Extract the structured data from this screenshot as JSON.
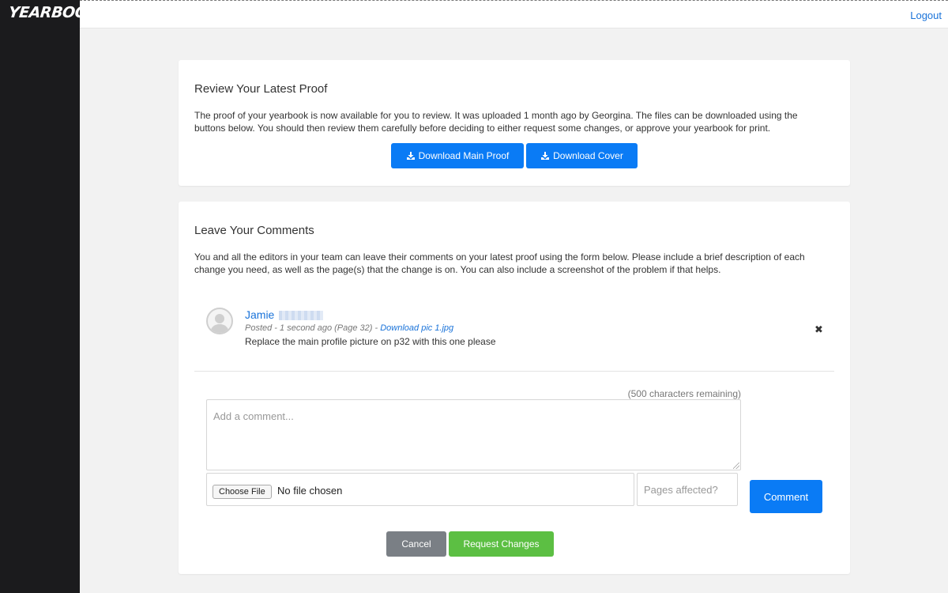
{
  "app": {
    "logo_text": "YEARBOOK",
    "logout_label": "Logout"
  },
  "proof_card": {
    "title": "Review Your Latest Proof",
    "description": "The proof of your yearbook is now available for you to review. It was uploaded 1 month ago by Georgina. The files can be downloaded using the buttons below. You should then review them carefully before deciding to either request some changes, or approve your yearbook for print.",
    "download_main_label": "Download Main Proof",
    "download_cover_label": "Download Cover"
  },
  "comments_card": {
    "title": "Leave Your Comments",
    "description": "You and all the editors in your team can leave their comments on your latest proof using the form below. Please include a brief description of each change you need, as well as the page(s) that the change is on. You can also include a screenshot of the problem if that helps.",
    "comments": [
      {
        "author": "Jamie",
        "meta_prefix": "Posted - 1 second ago (Page 32) - ",
        "attachment_label": "Download pic 1.jpg",
        "body": "Replace the main profile picture on p32 with this one please",
        "delete_symbol": "✖"
      }
    ],
    "form": {
      "chars_remaining": "(500 characters remaining)",
      "comment_placeholder": "Add a comment...",
      "choose_file_label": "Choose File",
      "no_file_text": "No file chosen",
      "pages_placeholder": "Pages affected?",
      "comment_button_label": "Comment"
    },
    "cancel_label": "Cancel",
    "request_changes_label": "Request Changes"
  },
  "colors": {
    "sidebar": "#1b1b1d",
    "primary": "#0a7bf5",
    "link": "#1a73d9",
    "success": "#5cbf43",
    "secondary": "#7a7f85"
  },
  "icons": {
    "download": "download-icon",
    "avatar": "user-avatar-icon",
    "delete": "close-icon"
  }
}
